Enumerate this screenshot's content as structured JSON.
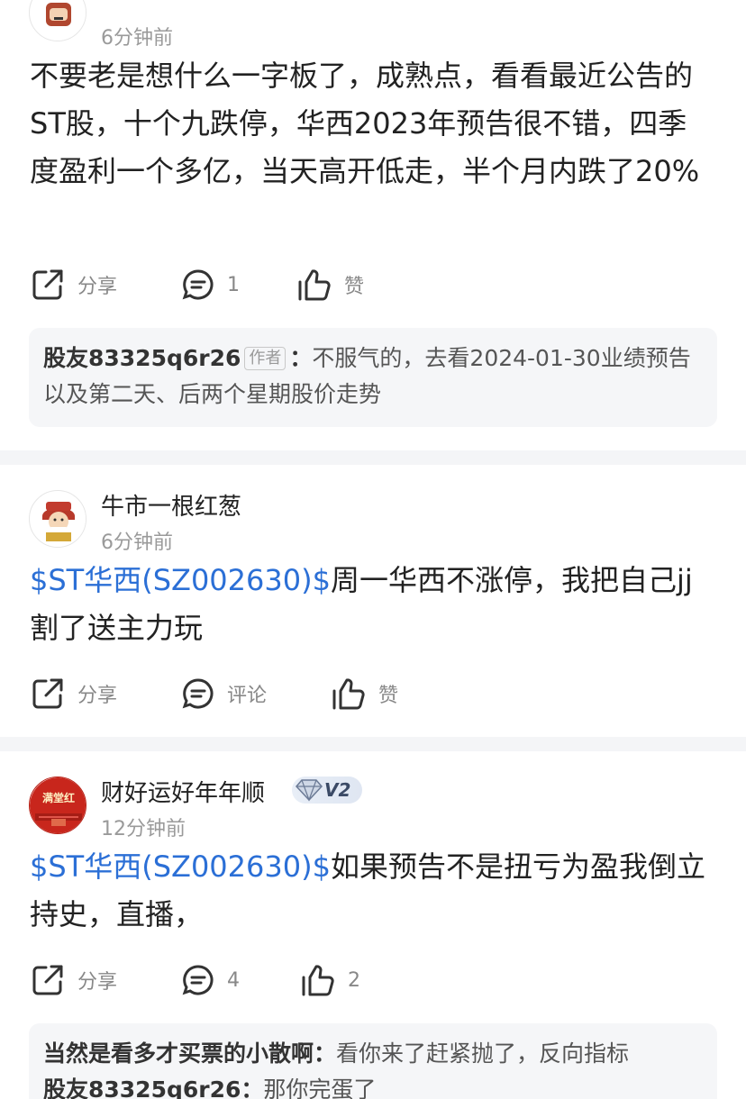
{
  "posts": [
    {
      "time": "6分钟前",
      "content": "不要老是想什么一字板了，成熟点，看看最近公告的ST股，十个九跌停，华西2023年预告很不错，四季度盈利一个多亿，当天高开低走，半个月内跌了20%",
      "actions": {
        "share": "分享",
        "comment": "1",
        "like": "赞"
      },
      "reply": {
        "author": "股友83325q6r26",
        "author_tag": "作者",
        "separator": "：",
        "text": "不服气的，去看2024-01-30业绩预告以及第二天、后两个星期股价走势"
      }
    },
    {
      "name": "牛市一根红葱",
      "time": "6分钟前",
      "stock_link": "$ST华西(SZ002630)$",
      "content": "周一华西不涨停，我把自己jj割了送主力玩",
      "actions": {
        "share": "分享",
        "comment": "评论",
        "like": "赞"
      }
    },
    {
      "name": "财好运好年年顺",
      "badge": "V2",
      "avatar_text": "满堂红",
      "time": "12分钟前",
      "stock_link": "$ST华西(SZ002630)$",
      "content": "如果预告不是扭亏为盈我倒立持史，直播，",
      "actions": {
        "share": "分享",
        "comment": "4",
        "like": "2"
      },
      "replies": [
        {
          "author": "当然是看多才买票的小散啊",
          "separator": "：",
          "text": "看你来了赶紧抛了，反向指标"
        },
        {
          "author": "股友83325q6r26",
          "separator": "：",
          "text": "那你完蛋了"
        }
      ]
    }
  ],
  "colors": {
    "link": "#2b6fd6",
    "divider": "#f4f5f7",
    "reply_bg": "#f5f6f8",
    "muted": "#9a9a9a"
  },
  "icons": {
    "share": "share-icon",
    "comment": "comment-icon",
    "like": "thumbs-up-icon",
    "vip": "diamond-icon"
  }
}
